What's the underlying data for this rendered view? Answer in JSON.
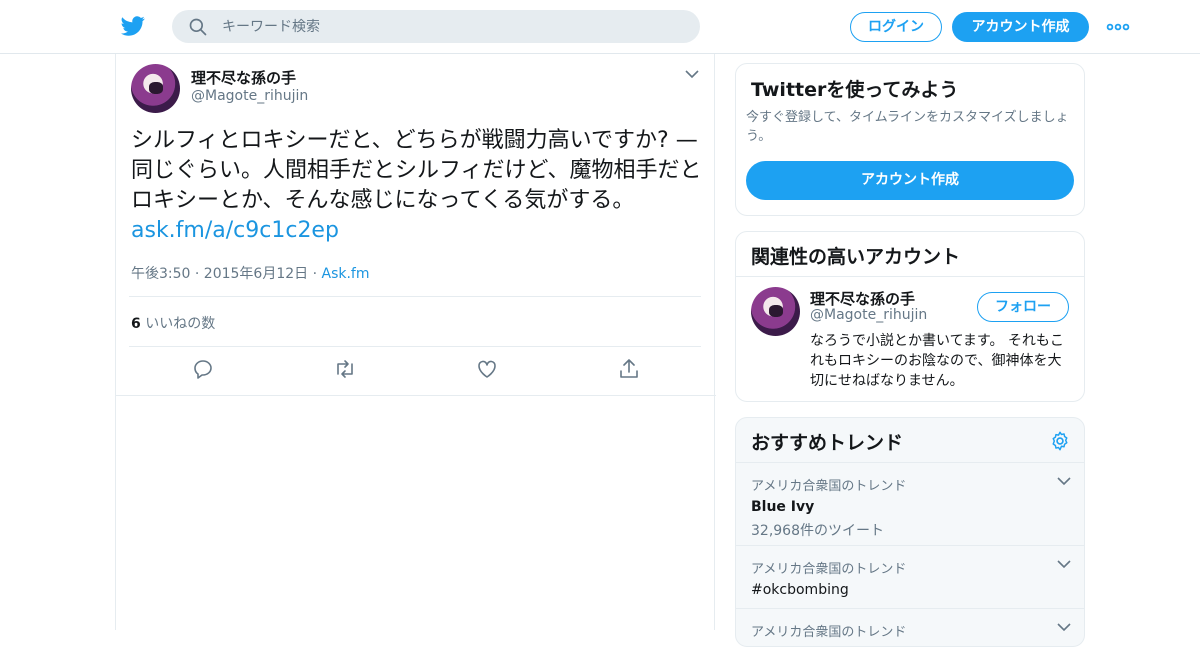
{
  "header": {
    "search_placeholder": "キーワード検索",
    "login_label": "ログイン",
    "signup_label": "アカウント作成"
  },
  "tweet": {
    "display_name": "理不尽な孫の手",
    "handle": "@Magote_rihujin",
    "text": "シルフィとロキシーだと、どちらが戦闘力高いですか? — 同じぐらい。人間相手だとシルフィだけど、魔物相手だとロキシーとか、そんな感じになってくる気がする。",
    "link": "ask.fm/a/c9c1c2ep",
    "timestamp": "午後3:50 · 2015年6月12日",
    "separator": "·",
    "source": "Ask.fm",
    "like_count": "6",
    "like_label": "いいねの数"
  },
  "sidebar": {
    "signup_card": {
      "title": "Twitterを使ってみよう",
      "description": "今すぐ登録して、タイムラインをカスタマイズしましょう。",
      "button": "アカウント作成"
    },
    "related_card": {
      "title": "関連性の高いアカウント",
      "name": "理不尽な孫の手",
      "handle": "@Magote_rihujin",
      "follow_label": "フォロー",
      "bio": "なろうで小説とか書いてます。 それもこれもロキシーのお陰なので、御神体を大切にせねばなりません。"
    },
    "trends_card": {
      "title": "おすすめトレンド",
      "items": [
        {
          "context": "アメリカ合衆国のトレンド",
          "name": "Blue Ivy",
          "count": "32,968件のツイート"
        },
        {
          "context": "アメリカ合衆国のトレンド",
          "name": "#okcbombing"
        },
        {
          "context": "アメリカ合衆国のトレンド"
        }
      ]
    }
  },
  "colors": {
    "accent": "#1da1f2",
    "link": "#1b95e0",
    "secondary_text": "#657786"
  }
}
